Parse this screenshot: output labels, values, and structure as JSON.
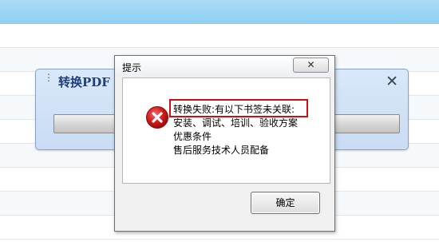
{
  "progress_panel": {
    "title": "转换PDF",
    "close_glyph": "✕",
    "drag_glyph": "⋮",
    "progress": 0
  },
  "dialog": {
    "title": "提示",
    "close_glyph": "✕",
    "icon": "error-icon",
    "message_lines": [
      "转换失败:有以下书签未关联:",
      "安装、调试、培训、验收方案",
      "优惠条件",
      "售后服务技术人员配备"
    ],
    "ok_label": "确定",
    "colors": {
      "error": "#cc1010",
      "highlight_border": "#cc1010"
    }
  }
}
